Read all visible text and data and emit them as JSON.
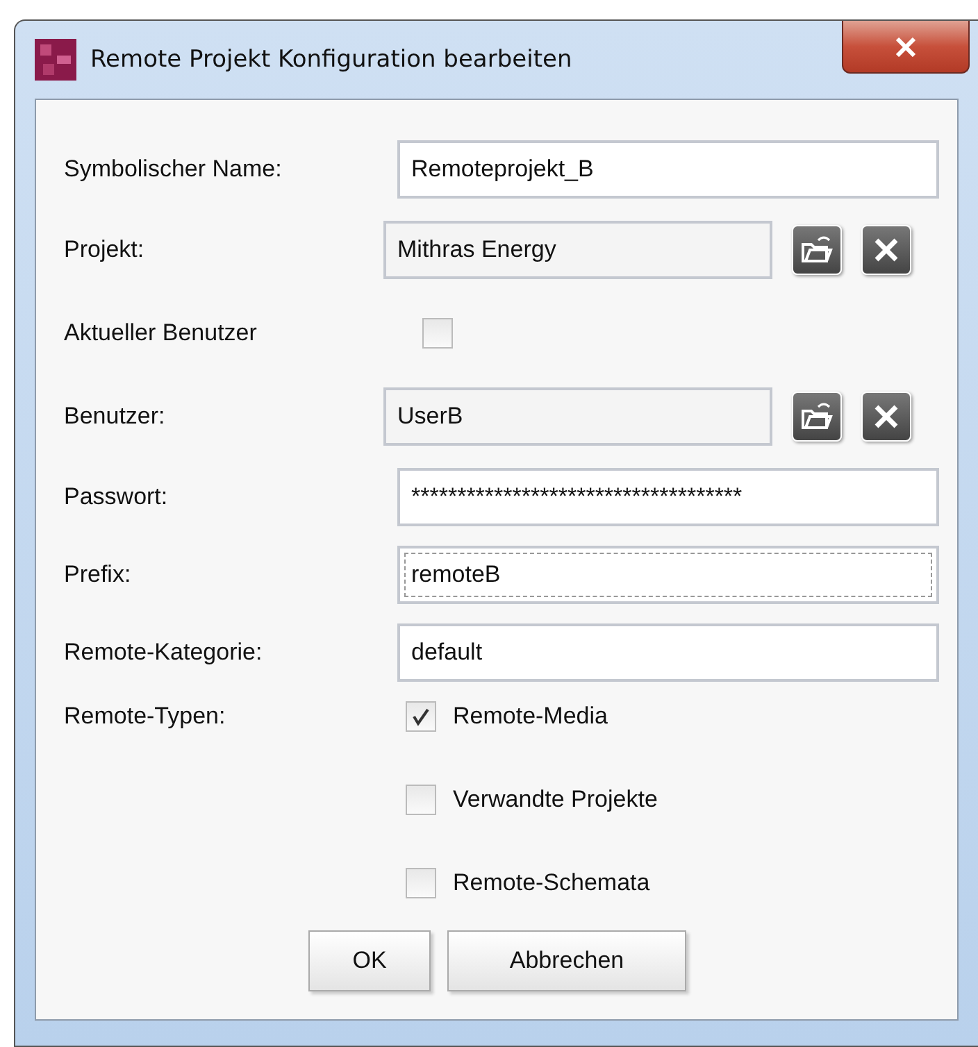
{
  "window": {
    "title": "Remote Projekt Konfiguration bearbeiten"
  },
  "fields": [
    {
      "kind": "text",
      "label": "Symbolischer Name:",
      "value": "Remoteprojekt_B",
      "focused": false
    },
    {
      "kind": "picker",
      "label": "Projekt:",
      "value": "Mithras Energy"
    },
    {
      "kind": "checkbox",
      "label": "Aktueller Benutzer",
      "checked": false
    },
    {
      "kind": "picker",
      "label": "Benutzer:",
      "value": "UserB"
    },
    {
      "kind": "text",
      "label": "Passwort:",
      "value": "************************************",
      "focused": false
    },
    {
      "kind": "text",
      "label": "Prefix:",
      "value": "remoteB",
      "focused": true
    },
    {
      "kind": "text",
      "label": "Remote-Kategorie:",
      "value": "default",
      "focused": false
    },
    {
      "kind": "checklist",
      "label": "Remote-Typen:",
      "options": [
        {
          "label": "Remote-Media",
          "checked": true
        },
        {
          "label": "Verwandte Projekte",
          "checked": false
        },
        {
          "label": "Remote-Schemata",
          "checked": false
        }
      ]
    }
  ],
  "buttons": [
    "OK",
    "Abbrechen"
  ]
}
